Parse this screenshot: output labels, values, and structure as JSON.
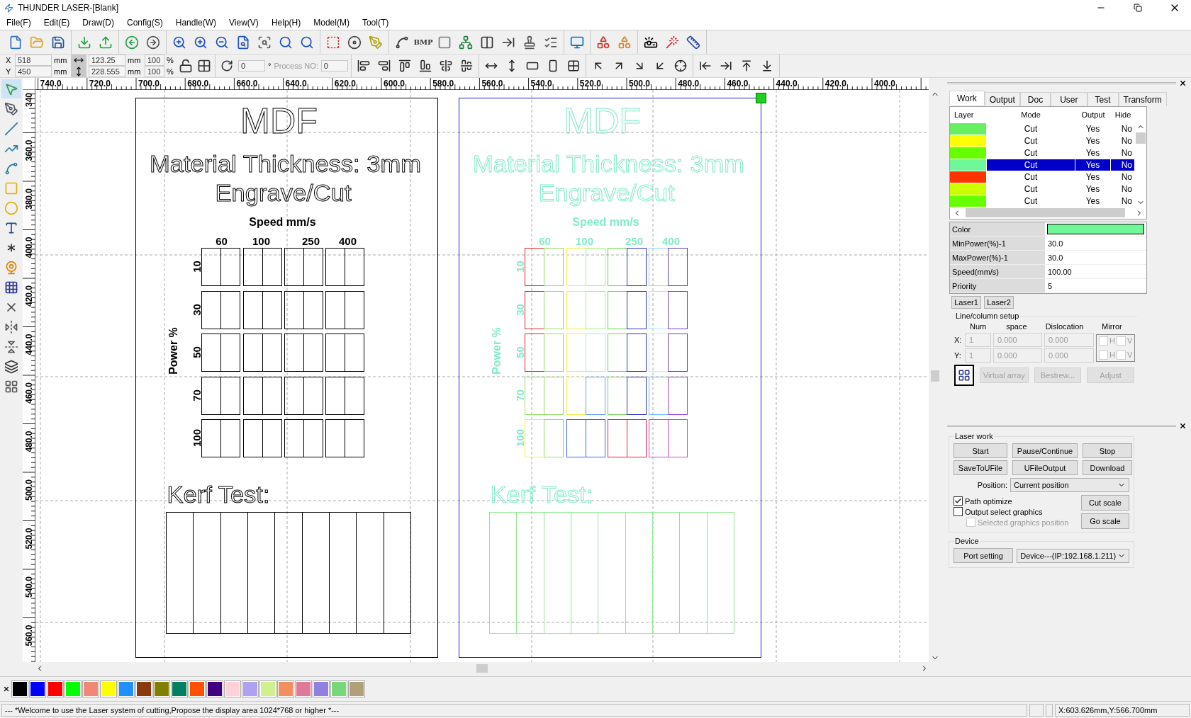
{
  "window": {
    "title": "THUNDER LASER-[Blank]"
  },
  "menu": [
    "File(F)",
    "Edit(E)",
    "Draw(D)",
    "Config(S)",
    "Handle(W)",
    "View(V)",
    "Help(H)",
    "Model(M)",
    "Tool(T)"
  ],
  "toolbar": {
    "bmp_label": "BMP"
  },
  "transform_bar": {
    "x": {
      "label": "X",
      "value": "518",
      "unit": "mm"
    },
    "y": {
      "label": "Y",
      "value": "450",
      "unit": "mm"
    },
    "width": {
      "value": "123.25",
      "unit": "mm"
    },
    "height": {
      "value": "228.555",
      "unit": "mm"
    },
    "scale_x": {
      "value": "100",
      "unit": "%"
    },
    "scale_y": {
      "value": "100",
      "unit": "%"
    },
    "locked": false,
    "angle": {
      "value": "0",
      "unit": "°"
    },
    "process_no": {
      "label": "Process NO:",
      "value": "0"
    }
  },
  "ruler": {
    "x_labels": [
      "740.0",
      "720.0",
      "700.0",
      "680.0",
      "660.0",
      "640.0",
      "620.0",
      "600.0",
      "580.0",
      "560.0",
      "540.0",
      "520.0",
      "500.0",
      "480.0",
      "460.0",
      "440.0",
      "420.0",
      "400.0"
    ],
    "y_labels": [
      "340",
      "360.0",
      "380.0",
      "400.0",
      "420.0",
      "440.0",
      "460.0",
      "480.0",
      "500.0",
      "520.0",
      "540.0",
      "560.0"
    ]
  },
  "plates": [
    {
      "selected": false,
      "color": "#000000",
      "title": "MDF",
      "subtitle": [
        "Material Thickness: 3mm",
        "Engrave/Cut"
      ],
      "speed_label": "Speed mm/s",
      "speeds": [
        "60",
        "100",
        "250",
        "400"
      ],
      "power_label": "Power %",
      "kerf": {
        "label": "Kerf Test:",
        "color": "#000000"
      },
      "rows": [
        {
          "label": "10",
          "cells": [
            {
              "color": "#000000"
            },
            {
              "color": "#000000"
            },
            {
              "color": "#000000"
            },
            {
              "color": "#000000"
            },
            {
              "color": "#000000"
            },
            {
              "color": "#000000"
            },
            {
              "color": "#000000"
            },
            {
              "color": "#000000"
            }
          ]
        },
        {
          "label": "30",
          "cells": [
            {
              "color": "#000000"
            },
            {
              "color": "#000000"
            },
            {
              "color": "#000000"
            },
            {
              "color": "#000000"
            },
            {
              "color": "#000000"
            },
            {
              "color": "#000000"
            },
            {
              "color": "#000000"
            },
            {
              "color": "#000000"
            }
          ]
        },
        {
          "label": "50",
          "cells": [
            {
              "color": "#000000"
            },
            {
              "color": "#000000"
            },
            {
              "color": "#000000"
            },
            {
              "color": "#000000"
            },
            {
              "color": "#000000"
            },
            {
              "color": "#000000"
            },
            {
              "color": "#000000"
            },
            {
              "color": "#000000"
            }
          ]
        },
        {
          "label": "70",
          "cells": [
            {
              "color": "#000000"
            },
            {
              "color": "#000000"
            },
            {
              "color": "#000000"
            },
            {
              "color": "#000000"
            },
            {
              "color": "#000000"
            },
            {
              "color": "#000000"
            },
            {
              "color": "#000000"
            },
            {
              "color": "#000000"
            }
          ]
        },
        {
          "label": "100",
          "cells": [
            {
              "color": "#000000"
            },
            {
              "color": "#000000"
            },
            {
              "color": "#000000"
            },
            {
              "color": "#000000"
            },
            {
              "color": "#000000"
            },
            {
              "color": "#000000"
            },
            {
              "color": "#000000"
            },
            {
              "color": "#000000"
            }
          ]
        }
      ]
    },
    {
      "selected": true,
      "color": "#80ecc8",
      "title": "MDF",
      "subtitle": [
        "Material Thickness: 3mm",
        "Engrave/Cut"
      ],
      "speed_label": "Speed mm/s",
      "speeds": [
        "60",
        "100",
        "250",
        "400"
      ],
      "power_label": "Power %",
      "kerf": {
        "label": "Kerf Test:",
        "color": "#90e890"
      },
      "rows": [
        {
          "label": "10",
          "cells": [
            {
              "color": "#e02020"
            },
            {
              "color": "#90e060"
            },
            {
              "color": "#f0f040"
            },
            {
              "color": "#a0f080"
            },
            {
              "color": "#70d050"
            },
            {
              "color": "#3030c0"
            },
            {
              "color": "#90d8f0"
            },
            {
              "color": "#6040c0"
            }
          ]
        },
        {
          "label": "30",
          "cells": [
            {
              "color": "#e02020"
            },
            {
              "color": "#90e060"
            },
            {
              "color": "#f0f040"
            },
            {
              "color": "#a0f080"
            },
            {
              "color": "#70d050"
            },
            {
              "color": "#3030c0"
            },
            {
              "color": "#a0e8f0"
            },
            {
              "color": "#7040c0"
            }
          ]
        },
        {
          "label": "50",
          "cells": [
            {
              "color": "#e02020"
            },
            {
              "color": "#90e060"
            },
            {
              "color": "#f0f040"
            },
            {
              "color": "#a0f0e0"
            },
            {
              "color": "#70d050"
            },
            {
              "color": "#3030c0"
            },
            {
              "color": "#c0f0f0"
            },
            {
              "color": "#6040c0"
            }
          ]
        },
        {
          "label": "70",
          "cells": [
            {
              "color": "#90e060"
            },
            {
              "color": "#90e060"
            },
            {
              "color": "#f0f040"
            },
            {
              "color": "#60a0f0"
            },
            {
              "color": "#70d050"
            },
            {
              "color": "#3030c0"
            },
            {
              "color": "#60c0f0"
            },
            {
              "color": "#a040c0"
            }
          ]
        },
        {
          "label": "100",
          "cells": [
            {
              "color": "#f0f040"
            },
            {
              "color": "#90e060"
            },
            {
              "color": "#3060f0"
            },
            {
              "color": "#3060f0"
            },
            {
              "color": "#e02040"
            },
            {
              "color": "#e02040"
            },
            {
              "color": "#d040d0"
            },
            {
              "color": "#d040d0"
            }
          ]
        }
      ]
    }
  ],
  "work_panel": {
    "tabs": [
      {
        "label": "Work",
        "selected": true
      },
      {
        "label": "Output",
        "selected": false
      },
      {
        "label": "Doc",
        "selected": false
      },
      {
        "label": "User",
        "selected": false
      },
      {
        "label": "Test",
        "selected": false
      },
      {
        "label": "Transform",
        "selected": false
      }
    ],
    "layer_columns": [
      "Layer",
      "Mode",
      "Output",
      "Hide"
    ],
    "layers": [
      {
        "color": "#66f060",
        "mode": "Cut",
        "output": "Yes",
        "hide": "No",
        "selected": false
      },
      {
        "color": "#ffff00",
        "mode": "Cut",
        "output": "Yes",
        "hide": "No",
        "selected": false
      },
      {
        "color": "#66ff00",
        "mode": "Cut",
        "output": "Yes",
        "hide": "No",
        "selected": false
      },
      {
        "color": "#70f898",
        "mode": "Cut",
        "output": "Yes",
        "hide": "No",
        "selected": true
      },
      {
        "color": "#ff3300",
        "mode": "Cut",
        "output": "Yes",
        "hide": "No",
        "selected": false
      },
      {
        "color": "#ccff00",
        "mode": "Cut",
        "output": "Yes",
        "hide": "No",
        "selected": false
      },
      {
        "color": "#66ff00",
        "mode": "Cut",
        "output": "Yes",
        "hide": "No",
        "selected": false
      }
    ],
    "properties": [
      {
        "kind": "color",
        "label": "Color",
        "color": "#70f898"
      },
      {
        "kind": "text",
        "label": "MinPower(%)-1",
        "value": "30.0"
      },
      {
        "kind": "text",
        "label": "MaxPower(%)-1",
        "value": "30.0"
      },
      {
        "kind": "text",
        "label": "Speed(mm/s)",
        "value": "100.00"
      },
      {
        "kind": "text",
        "label": "Priority",
        "value": "5"
      }
    ],
    "laser_buttons": [
      "Laser1",
      "Laser2"
    ],
    "array_setup": {
      "title": "Line/column setup",
      "columns": [
        "Num",
        "space",
        "Dislocation",
        "Mirror"
      ],
      "rows": [
        {
          "label": "X:",
          "num": "1",
          "space": "0.000",
          "dislocation": "0.000",
          "mirror": [
            {
              "label": "H",
              "checked": false
            },
            {
              "label": "V",
              "checked": false
            }
          ]
        },
        {
          "label": "Y:",
          "num": "1",
          "space": "0.000",
          "dislocation": "0.000",
          "mirror": [
            {
              "label": "H",
              "checked": false
            },
            {
              "label": "V",
              "checked": false
            }
          ]
        }
      ],
      "buttons": [
        {
          "label": "Virtual array",
          "disabled": true
        },
        {
          "label": "Bestrew...",
          "disabled": true
        },
        {
          "label": "Adjust",
          "disabled": true
        }
      ]
    }
  },
  "laser_panel": {
    "title": "Laser work",
    "buttons": [
      "Start",
      "Pause/Continue",
      "Stop",
      "SaveToUFile",
      "UFileOutput",
      "Download"
    ],
    "position": {
      "label": "Position:",
      "value": "Current position"
    },
    "options": [
      {
        "label": "Path optimize",
        "checked": true,
        "disabled": false
      },
      {
        "label": "Output select graphics",
        "checked": false,
        "disabled": false
      },
      {
        "label": "Selected graphics position",
        "checked": false,
        "disabled": true
      }
    ],
    "scale_buttons": [
      "Cut scale",
      "Go scale"
    ],
    "device": {
      "title": "Device",
      "button": "Port setting",
      "value": "Device---(IP:192.168.1.211)"
    }
  },
  "palette": [
    {
      "color": "#000000"
    },
    {
      "color": "#0000ff"
    },
    {
      "color": "#ff0000"
    },
    {
      "color": "#00ff00"
    },
    {
      "color": "#f08878"
    },
    {
      "color": "#ffff00"
    },
    {
      "color": "#2090ff"
    },
    {
      "color": "#8b3a10"
    },
    {
      "color": "#808000"
    },
    {
      "color": "#008060"
    },
    {
      "color": "#ff5000"
    },
    {
      "color": "#400080"
    },
    {
      "color": "#ffd0d8"
    },
    {
      "color": "#b0a0f0"
    },
    {
      "color": "#d0f090"
    },
    {
      "color": "#f09060"
    },
    {
      "color": "#e07898"
    },
    {
      "color": "#9080e0"
    },
    {
      "color": "#78d878"
    },
    {
      "color": "#b0a078"
    }
  ],
  "status_bar": {
    "message": "--- *Welcome to use the Laser system of cutting,Propose the display area 1024*768 or higher *---",
    "position": "X:603.626mm,Y:566.700mm"
  }
}
